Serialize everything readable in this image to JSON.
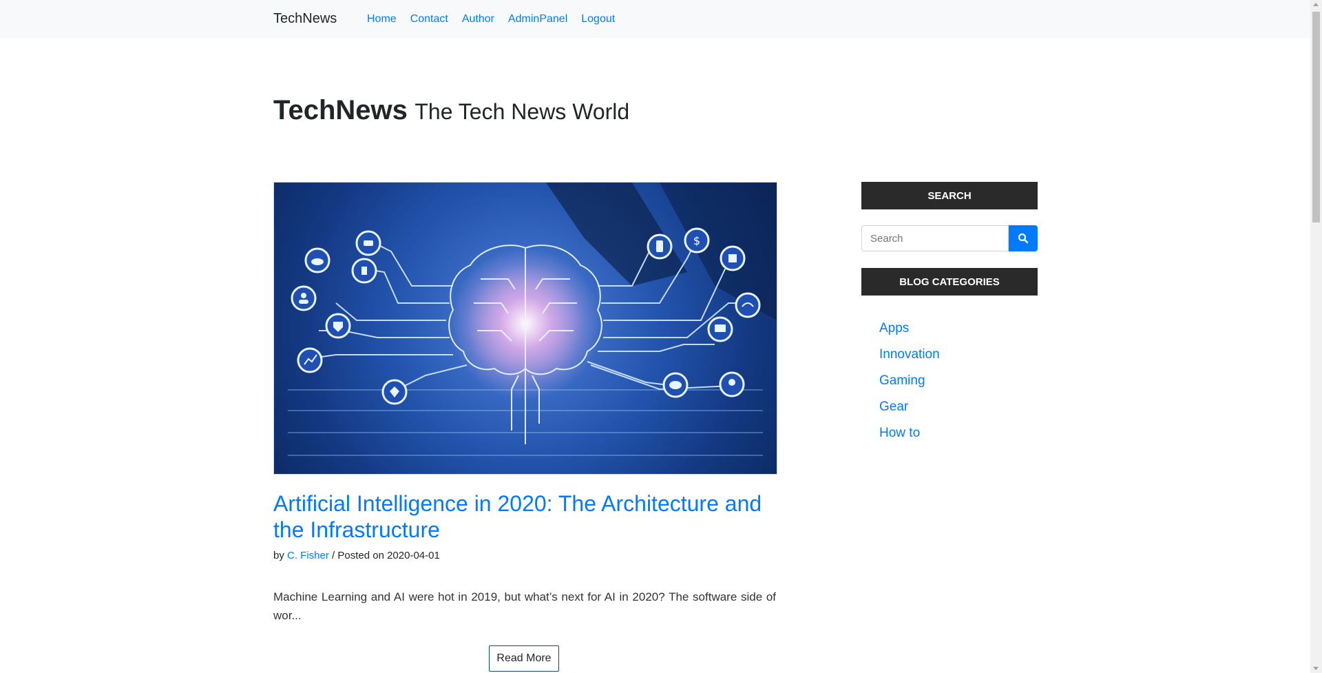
{
  "navbar": {
    "brand": "TechNews",
    "links": [
      "Home",
      "Contact",
      "Author",
      "AdminPanel",
      "Logout"
    ]
  },
  "header": {
    "title": "TechNews",
    "tagline": "The Tech News World"
  },
  "post": {
    "title": "Artificial Intelligence in 2020: The Architecture and the Infrastructure",
    "by_label": "by",
    "author": "C. Fisher",
    "posted_label": "/ Posted on",
    "date": "2020-04-01",
    "excerpt": "Machine Learning and AI were hot in 2019, but what’s next for AI in 2020? The software side of wor...",
    "read_more": "Read More"
  },
  "sidebar": {
    "search_heading": "SEARCH",
    "search_placeholder": "Search",
    "categories_heading": "BLOG CATEGORIES",
    "categories": [
      "Apps",
      "Innovation",
      "Gaming",
      "Gear",
      "How to"
    ]
  },
  "colors": {
    "link": "#007bff",
    "navbar_bg": "#f8f9fa",
    "sidebar_heading_bg": "#2a2a2a",
    "search_button": "#007bff"
  }
}
